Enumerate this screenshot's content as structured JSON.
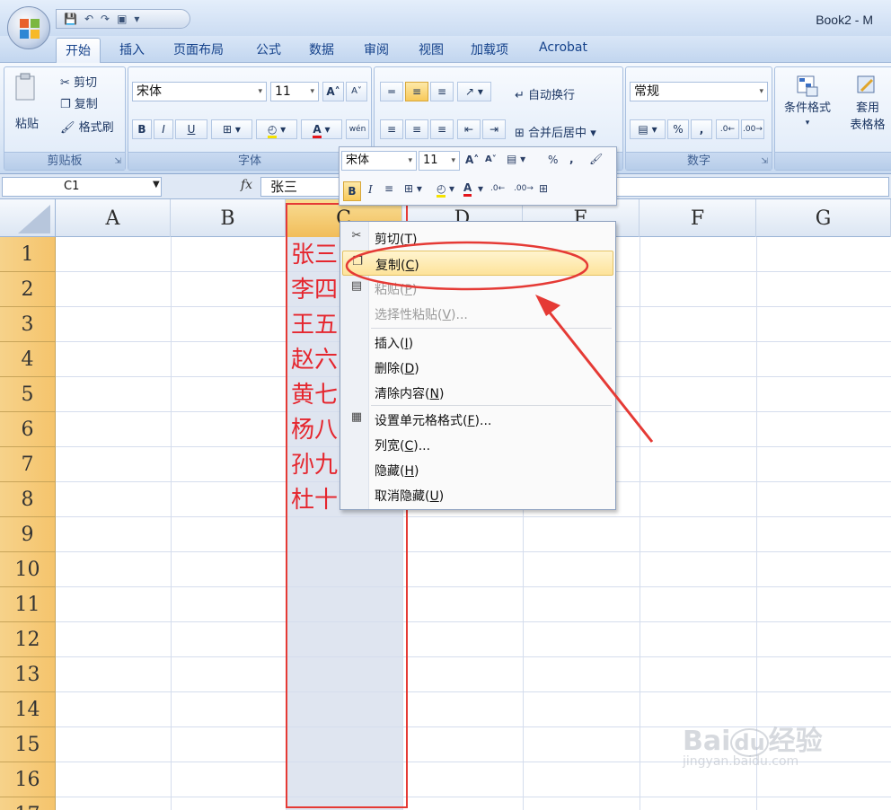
{
  "app_title": "Book2 - M",
  "quick_access": [
    "save-icon",
    "undo-icon",
    "redo-icon",
    "camera-icon"
  ],
  "tabs": [
    "开始",
    "插入",
    "页面布局",
    "公式",
    "数据",
    "审阅",
    "视图",
    "加载项",
    "Acrobat"
  ],
  "ribbon": {
    "clipboard": {
      "label": "剪贴板",
      "paste": "粘贴",
      "cut": "剪切",
      "copy": "复制",
      "format_painter": "格式刷"
    },
    "font": {
      "label": "字体",
      "name": "宋体",
      "size": "11",
      "grow": "A",
      "shrink": "A",
      "bold": "B",
      "italic": "I",
      "underline": "U",
      "font_color_letter": "A",
      "phonetic": "wén"
    },
    "alignment": {
      "wrap": "自动换行",
      "merge": "合并后居中"
    },
    "number": {
      "label": "数字",
      "format": "常规",
      "percent": "%",
      "comma": ","
    },
    "styles": {
      "conditional": "条件格式",
      "table_style_1": "套用",
      "table_style_2": "表格格"
    }
  },
  "formula_bar": {
    "name_box": "C1",
    "fx": "fx",
    "value": "张三"
  },
  "columns": [
    "A",
    "B",
    "C",
    "D",
    "E",
    "F",
    "G"
  ],
  "rows": [
    "1",
    "2",
    "3",
    "4",
    "5",
    "6",
    "7",
    "8",
    "9",
    "10",
    "11",
    "12",
    "13",
    "14",
    "15",
    "16",
    "17"
  ],
  "column_c_values": [
    "张三",
    "李四",
    "王五",
    "赵六",
    "黄七",
    "杨八",
    "孙九",
    "杜十"
  ],
  "mini_toolbar": {
    "font": "宋体",
    "size": "11",
    "bold": "B",
    "italic": "I",
    "percent": "%",
    "comma": ","
  },
  "context_menu": [
    {
      "label": "剪切",
      "key": "T",
      "icon": "scissors-icon",
      "state": "normal"
    },
    {
      "label": "复制",
      "key": "C",
      "icon": "copy-icon",
      "state": "highlighted"
    },
    {
      "label": "粘贴",
      "key": "P",
      "icon": "paste-icon",
      "state": "disabled"
    },
    {
      "label": "选择性粘贴",
      "key": "V",
      "suffix": "...",
      "icon": "",
      "state": "disabled"
    },
    {
      "label": "插入",
      "key": "I",
      "icon": "",
      "state": "normal"
    },
    {
      "label": "删除",
      "key": "D",
      "icon": "",
      "state": "normal"
    },
    {
      "label": "清除内容",
      "key": "N",
      "icon": "",
      "state": "normal"
    },
    {
      "label": "设置单元格格式",
      "key": "F",
      "suffix": "...",
      "icon": "format-cells-icon",
      "state": "normal"
    },
    {
      "label": "列宽",
      "key": "C",
      "suffix": "...",
      "icon": "",
      "state": "normal"
    },
    {
      "label": "隐藏",
      "key": "H",
      "icon": "",
      "state": "normal"
    },
    {
      "label": "取消隐藏",
      "key": "U",
      "icon": "",
      "state": "normal"
    }
  ],
  "watermark": {
    "brand": "Bai",
    "brand2": "du",
    "cn": "经验",
    "site": "jingyan.baidu.com"
  },
  "colors": {
    "annotation_red": "#e53a35",
    "cell_text_red": "#e5262e",
    "row_header": "#f5c46c"
  }
}
